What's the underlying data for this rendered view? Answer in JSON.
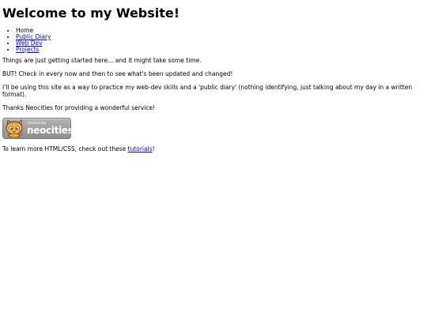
{
  "page": {
    "title": "Welcome to my Website!"
  },
  "nav": {
    "items": [
      {
        "label": "Home",
        "link": false
      },
      {
        "label": "Public Diary",
        "link": true
      },
      {
        "label": "Web Dev",
        "link": true
      },
      {
        "label": "Projects",
        "link": true
      }
    ]
  },
  "content": {
    "para1": "Things are just getting started here... and it might take some time.",
    "para2": "BUT! Check in every now and then to see what's been updated and changed!",
    "para3": "I'll be using this site as a way to practice my web-dev skills and a 'public diary' (nothing identifying, just talking about my day in a written format).",
    "para4": "Thanks Neocities for providing a wonderful service!",
    "learn_prefix": "To learn more HTML/CSS, check out these ",
    "learn_link": "tutorials",
    "learn_suffix": "!"
  },
  "badge": {
    "small_text": "hosted by",
    "big_text": "neocities",
    "icon": "neocities-cat-icon"
  },
  "colors": {
    "link": "#0000ee",
    "text": "#000000",
    "badge_bg": "#a0a0a0"
  }
}
